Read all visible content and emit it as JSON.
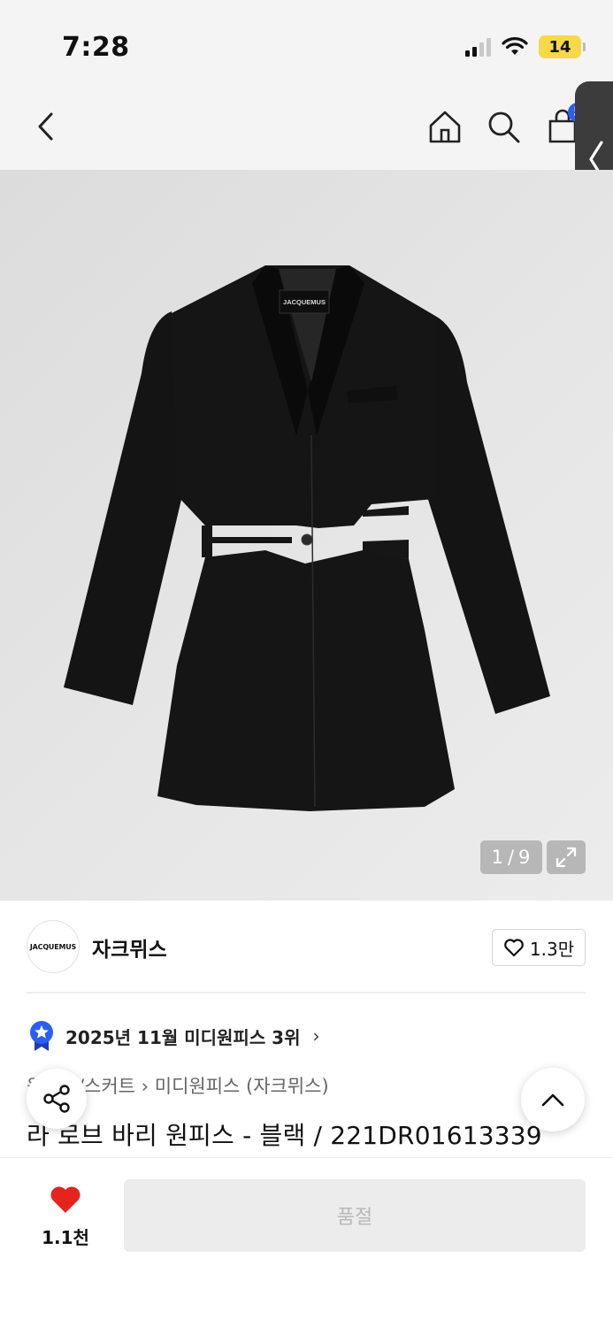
{
  "status_bar": {
    "time": "7:28",
    "battery": "14",
    "icons": [
      "signal-icon",
      "wifi-icon",
      "battery-icon"
    ]
  },
  "nav": {
    "icons": [
      "back-arrow-icon",
      "home-icon",
      "search-icon",
      "cart-icon"
    ],
    "cart_badge": "5"
  },
  "gallery": {
    "image": "black blazer dress with side cutouts",
    "label_text": "JACQUEMUS",
    "current": "1",
    "separator": "/",
    "total": "9"
  },
  "brand": {
    "logo_text": "JACQUEMUS",
    "name": "자크뮈스",
    "like_count": "1.3만"
  },
  "ranking": {
    "text": "2025년 11월 미디원피스 3위",
    "chevron": "›"
  },
  "breadcrumb": {
    "text": "원피스/스커트 › 미디원피스 (자크뮈스)"
  },
  "product": {
    "title": "라 로브 바리 원피스 - 블랙 / 221DR01613339"
  },
  "bottom_bar": {
    "wish_count": "1.1천",
    "buy_label": "품절"
  },
  "colors": {
    "accent_blue": "#2b5ff0",
    "heart_red": "#e5241d",
    "battery_yellow": "#f6d84a"
  }
}
